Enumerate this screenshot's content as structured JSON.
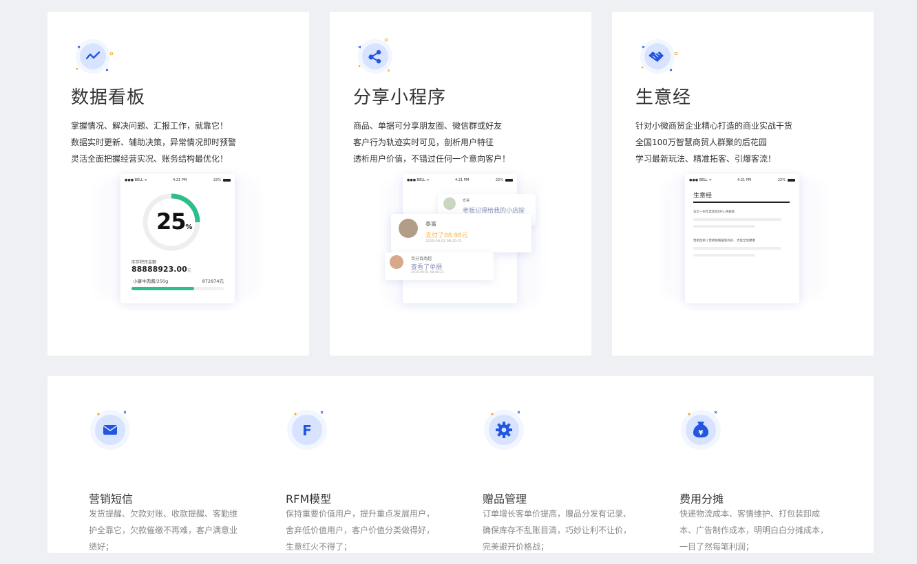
{
  "colors": {
    "accent": "#2255e0",
    "green": "#2dbe8a",
    "orange": "#f5a623",
    "bg": "#eef0f4"
  },
  "cards": [
    {
      "icon": "trend-line-icon",
      "title": "数据看板",
      "desc": [
        "掌握情况、解决问题、汇报工作，就靠它！",
        "数据实时更新、辅助决策，异常情况即时预警",
        "灵活全面把握经营实况、账务结构最优化！"
      ],
      "phone": {
        "status_left": "●●● BELL ᯤ",
        "status_time": "4:21 PM",
        "status_right": "22%",
        "percent": "25",
        "percent_unit": "%",
        "progress_fraction": 0.25,
        "label": "库存积压金额",
        "amount": "88888923.00",
        "amount_unit": "元",
        "item_name": "小康牛肉酱/250g",
        "item_value": "872974元",
        "item_bar_fraction": 0.68
      }
    },
    {
      "icon": "share-icon",
      "title": "分享小程序",
      "desc": [
        "商品、单据可分享朋友圈、微信群或好友",
        "客户行为轨迹实时可见，剖析用户特征",
        "透析用户价值，不错过任何一个意向客户！"
      ],
      "phone": {
        "status_left": "●●● BELL ᯤ",
        "status_time": "4:21 PM",
        "status_right": "22%",
        "bubble1_name": "宏哥",
        "bubble1_text": "老板记得给我的小店按",
        "bubble2_name": "泰富",
        "bubble2_text": "支付了88.98元",
        "bubble2_time": "2019-09-01 08:20:21",
        "bubble3_name": "百分百商超",
        "bubble3_text": "查看了单据",
        "bubble3_time": "2019-09-01 08:00:21"
      }
    },
    {
      "icon": "handshake-icon",
      "title": "生意经",
      "desc": [
        "针对小微商贸企业精心打造的商业实战干货",
        "全国100万智慧商贸人群聚的后花园",
        "学习最新玩法、精准拓客、引爆客流！"
      ],
      "phone": {
        "status_left": "●●● BELL ᯤ",
        "status_time": "4:21 PM",
        "status_right": "22%",
        "header": "生意经",
        "article1": "忘年一份年度收官好礼,待查收",
        "article2": "营销案例 | 营销策略最新的好，才能全场爆爆"
      }
    }
  ],
  "bottom": [
    {
      "icon": "mail-icon",
      "title": "营销短信",
      "desc": [
        "发货提醒、欠款对账、收款提醒、客勤维",
        "护全靠它，欠款催缴不再难，客户满意业",
        "绩好；"
      ]
    },
    {
      "icon": "rfm-f-icon",
      "glyph": "F",
      "title": "RFM模型",
      "desc": [
        "保持重要价值用户，提升重点发展用户，",
        "舍弃低价值用户，客户价值分类做得好，",
        "生意红火不得了；"
      ]
    },
    {
      "icon": "gear-icon",
      "title": "赠品管理",
      "desc": [
        "订单增长客单价提高，赠品分发有记录、",
        "确保库存不乱账目清，巧妙让利不让价，",
        "完美避开价格战；"
      ]
    },
    {
      "icon": "money-bag-icon",
      "glyph": "¥",
      "title": "费用分摊",
      "desc": [
        "快递物流成本、客情维护、打包装卸成",
        "本、广告制作成本，明明白白分摊成本，",
        "一目了然每笔利润；"
      ]
    }
  ]
}
